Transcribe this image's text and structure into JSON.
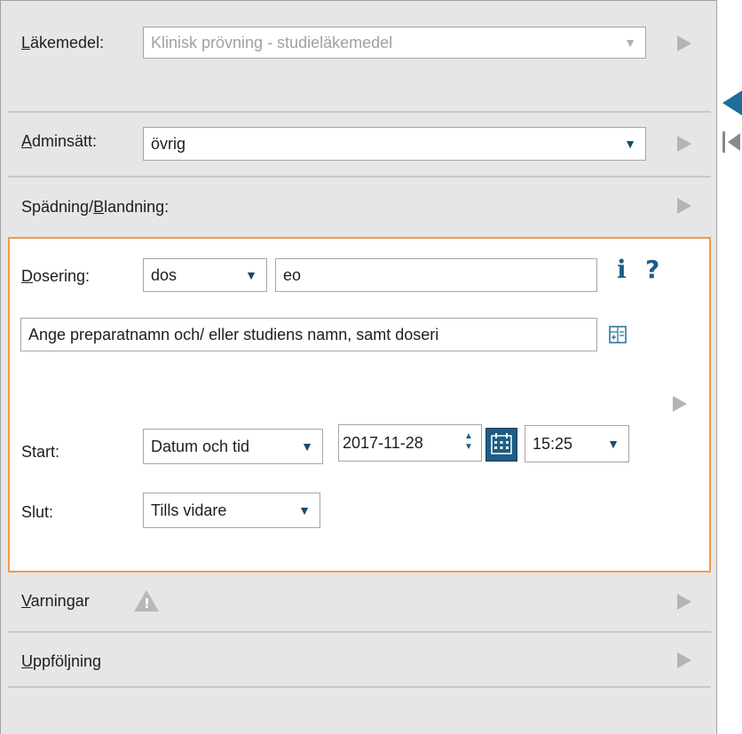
{
  "medicine": {
    "label_prefix": "L",
    "label_rest": "äkemedel:",
    "value": "Klinisk prövning - studieläkemedel",
    "dropdown_glyph": "▼"
  },
  "admin": {
    "label_prefix": "A",
    "label_rest": "dminsätt:",
    "value": "övrig",
    "dropdown_glyph": "▼"
  },
  "dilution": {
    "label_before": "Spädning/",
    "label_underlined": "B",
    "label_after": "landning:"
  },
  "dosage": {
    "label_prefix": "D",
    "label_rest": "osering:",
    "unit_value": "dos",
    "amount_value": "eo",
    "dropdown_glyph": "▼",
    "info_glyph": "i",
    "help_glyph": "?",
    "instruction_text": "Ange preparatnamn och/ eller studiens namn, samt doseri"
  },
  "start": {
    "label": "Start:",
    "mode_value": "Datum och tid",
    "date_value": "2017-11-28",
    "time_value": "15:25",
    "dropdown_glyph": "▼"
  },
  "end": {
    "label": "Slut:",
    "mode_value": "Tills vidare",
    "dropdown_glyph": "▼"
  },
  "warnings": {
    "label_prefix": "V",
    "label_rest": "arningar"
  },
  "followup": {
    "label_prefix": "U",
    "label_rest": "ppföljning"
  },
  "colors": {
    "accent": "#1f5d85",
    "active_border": "#f29a4c",
    "panel_bg": "#e6e6e6"
  }
}
